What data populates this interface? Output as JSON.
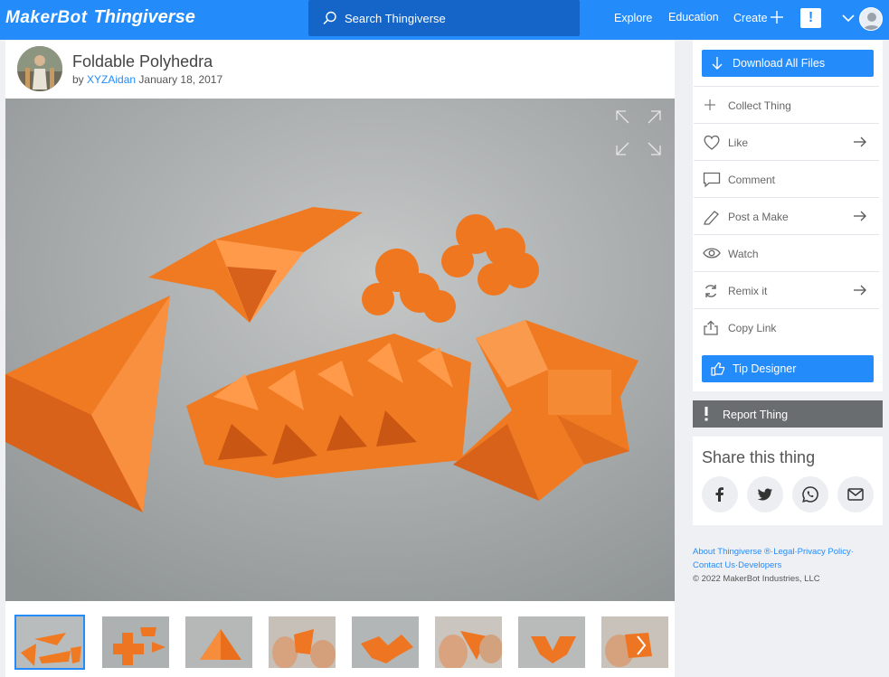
{
  "header": {
    "logo_maker": "MakerBot",
    "logo_thing": "Thingiverse",
    "search_placeholder": "Search Thingiverse",
    "nav": {
      "explore": "Explore",
      "education": "Education",
      "create": "Create"
    },
    "notification_badge": "!",
    "brand_color": "#248bfb"
  },
  "thing": {
    "title": "Foldable Polyhedra",
    "by": "by",
    "author": "XYZAidan",
    "date": "January 18, 2017"
  },
  "gallery": {
    "thumbnails": [
      "thumb-1",
      "thumb-2",
      "thumb-3",
      "thumb-4",
      "thumb-5",
      "thumb-6",
      "thumb-7",
      "thumb-8"
    ],
    "active_index": 0
  },
  "sidebar": {
    "download": "Download All Files",
    "actions": [
      {
        "label": "Collect Thing",
        "icon": "plus-icon",
        "has_arrow": false
      },
      {
        "label": "Like",
        "icon": "heart-icon",
        "has_arrow": true
      },
      {
        "label": "Comment",
        "icon": "comment-icon",
        "has_arrow": false
      },
      {
        "label": "Post a Make",
        "icon": "pen-icon",
        "has_arrow": true
      },
      {
        "label": "Watch",
        "icon": "eye-icon",
        "has_arrow": false
      },
      {
        "label": "Remix it",
        "icon": "remix-icon",
        "has_arrow": true
      },
      {
        "label": "Copy Link",
        "icon": "share-icon",
        "has_arrow": false
      }
    ],
    "tip": "Tip Designer",
    "report": "Report Thing"
  },
  "share": {
    "title": "Share this thing",
    "buttons": [
      "facebook-icon",
      "twitter-icon",
      "whatsapp-icon",
      "email-icon"
    ]
  },
  "footer": {
    "about": "About Thingiverse ®",
    "sep1": "·",
    "legal": "Legal",
    "sep2": "·",
    "privacy": "Privacy Policy",
    "sep3": "·",
    "contact": "Contact Us",
    "sep4": "·",
    "developers": "Developers",
    "copyright": "© 2022 MakerBot Industries, LLC"
  }
}
